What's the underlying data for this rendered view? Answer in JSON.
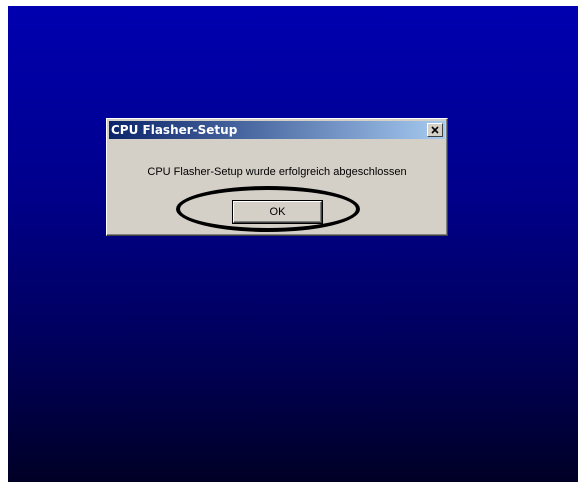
{
  "dialog": {
    "title": "CPU Flasher-Setup",
    "message": "CPU Flasher-Setup wurde erfolgreich abgeschlossen",
    "ok_label": "OK",
    "close_icon": "close-icon"
  },
  "colors": {
    "desktop_top": "#0000b0",
    "desktop_bottom": "#000026",
    "titlebar_start": "#0a246a",
    "titlebar_end": "#a6caf0",
    "dialog_face": "#d4d0c8",
    "annotation": "#000000"
  }
}
